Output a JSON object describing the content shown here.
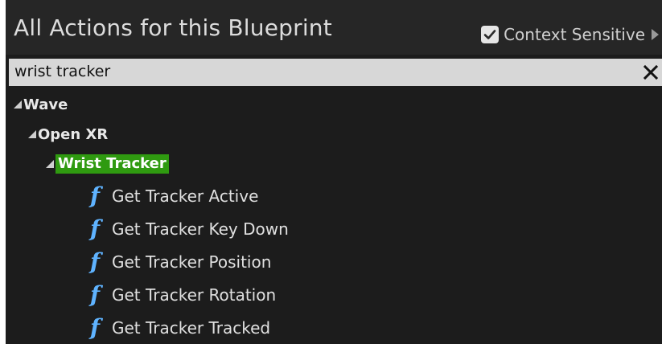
{
  "panel": {
    "title": "All Actions for this Blueprint",
    "context_sensitive": {
      "label": "Context Sensitive",
      "checked": true
    }
  },
  "search": {
    "value": "wrist tracker",
    "clear_icon": "close-icon"
  },
  "tree": {
    "root": "Wave",
    "child": "Open XR",
    "grandchild": "Wrist Tracker",
    "functions": [
      "Get Tracker Active",
      "Get Tracker Key Down",
      "Get Tracker Position",
      "Get Tracker Rotation",
      "Get Tracker Tracked"
    ],
    "function_icon_glyph": "f"
  },
  "colors": {
    "panel_bg": "#1c1c1c",
    "header_bg": "#262626",
    "search_bg": "#d7d7d7",
    "highlight": "#2f9a10",
    "function_icon": "#5fb3ff"
  }
}
